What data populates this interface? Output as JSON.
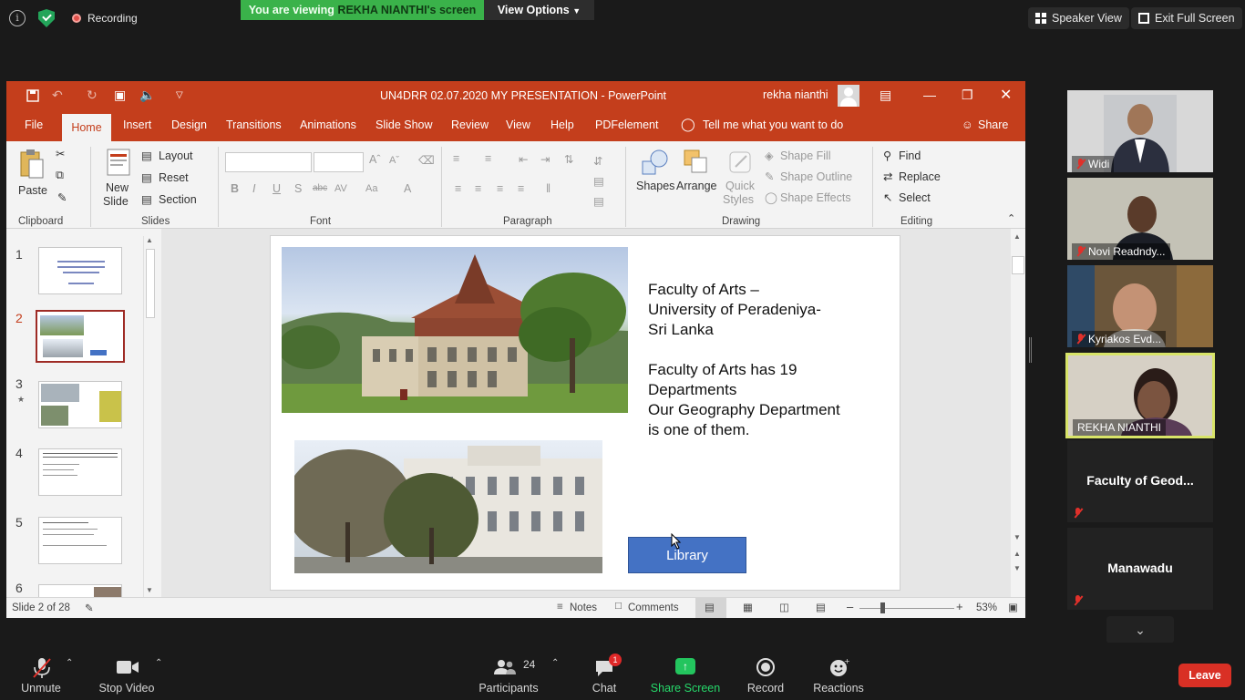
{
  "zoom": {
    "recording_label": "Recording",
    "viewing_banner_prefix": "You are viewing ",
    "viewing_banner_name": "REKHA NIANTHI's screen",
    "view_options_label": "View Options",
    "speaker_view_label": "Speaker View",
    "exit_fullscreen_label": "Exit Full Screen",
    "participants": [
      {
        "name": "Widi",
        "muted": true
      },
      {
        "name": "Novi Readndy...",
        "muted": true
      },
      {
        "name": "Kyriakos Evd...",
        "muted": true
      },
      {
        "name": "REKHA NIANTHI",
        "muted": false,
        "active_speaker": true
      },
      {
        "name": "Faculty of Geod...",
        "muted": true,
        "video": false
      },
      {
        "name": "Manawadu",
        "muted": true,
        "video": false
      }
    ],
    "toolbar": {
      "unmute": "Unmute",
      "stop_video": "Stop Video",
      "participants": "Participants",
      "participants_count": "24",
      "chat": "Chat",
      "chat_badge": "1",
      "share_screen": "Share Screen",
      "record": "Record",
      "reactions": "Reactions",
      "leave": "Leave"
    }
  },
  "ppt": {
    "title": "UN4DRR 02.07.2020 MY PRESENTATION  -  PowerPoint",
    "user_name": "rekha nianthi",
    "tabs": [
      "File",
      "Home",
      "Insert",
      "Design",
      "Transitions",
      "Animations",
      "Slide Show",
      "Review",
      "View",
      "Help",
      "PDFelement"
    ],
    "tell_me": "Tell me what you want to do",
    "share": "Share",
    "ribbon": {
      "clipboard": {
        "paste": "Paste",
        "group": "Clipboard"
      },
      "slides": {
        "new_slide_1": "New",
        "new_slide_2": "Slide",
        "layout": "Layout",
        "reset": "Reset",
        "section": "Section",
        "group": "Slides"
      },
      "font": {
        "group": "Font"
      },
      "paragraph": {
        "group": "Paragraph"
      },
      "drawing": {
        "shapes": "Shapes",
        "arrange": "Arrange",
        "quick_styles_1": "Quick",
        "quick_styles_2": "Styles",
        "shape_fill": "Shape Fill",
        "shape_outline": "Shape Outline",
        "shape_effects": "Shape Effects",
        "group": "Drawing"
      },
      "editing": {
        "find": "Find",
        "replace": "Replace",
        "select": "Select",
        "group": "Editing"
      }
    },
    "thumbnails": [
      "1",
      "2",
      "3",
      "4",
      "5",
      "6"
    ],
    "selected_slide": 2,
    "slide": {
      "text_lines": [
        "Faculty of Arts –",
        "University of Peradeniya-",
        "Sri Lanka",
        "",
        "Faculty of Arts has 19",
        "Departments",
        "Our Geography Department",
        "is one of them."
      ],
      "button_label": "Library"
    },
    "status": {
      "slide_info": "Slide 2 of 28",
      "notes": "Notes",
      "comments": "Comments",
      "zoom": "53%"
    }
  }
}
